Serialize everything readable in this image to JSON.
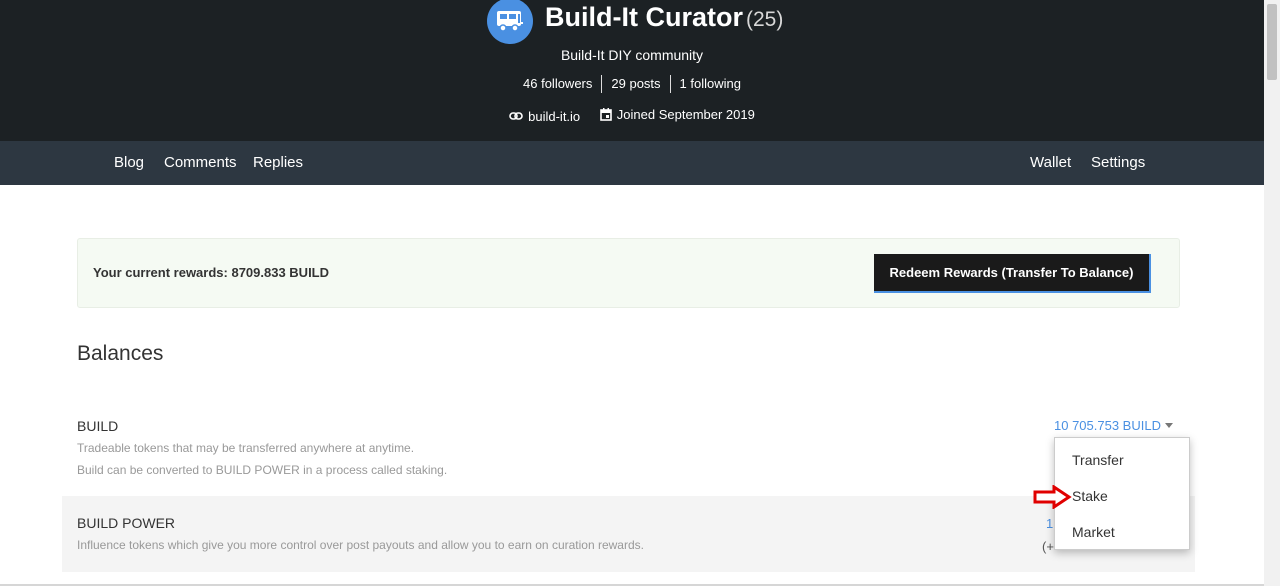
{
  "profile": {
    "name": "Build-It Curator",
    "reputation": "(25)",
    "about": "Build-It DIY community",
    "stats": {
      "followers": "46 followers",
      "posts": "29 posts",
      "following": "1 following"
    },
    "website": "build-it.io",
    "joined": "Joined September 2019",
    "avatar_icon": "camper-van-icon",
    "avatar_color": "#4a90e2"
  },
  "nav": {
    "blog": "Blog",
    "comments": "Comments",
    "replies": "Replies",
    "wallet": "Wallet",
    "settings": "Settings"
  },
  "rewards": {
    "text": "Your current rewards: 8709.833 BUILD",
    "redeem_label": "Redeem Rewards (Transfer To Balance)"
  },
  "balances": {
    "title": "Balances",
    "build": {
      "name": "BUILD",
      "desc1": "Tradeable tokens that may be transferred anywhere at anytime.",
      "desc2": "Build can be converted to BUILD POWER in a process called staking.",
      "value": "10 705.753 BUILD"
    },
    "build_power": {
      "name": "BUILD POWER",
      "desc": "Influence tokens which give you more control over post payouts and allow you to earn on curation rewards.",
      "value_partial": "1",
      "delegated_partial": "(+"
    }
  },
  "dropdown": {
    "options": [
      "Transfer",
      "Stake",
      "Market"
    ]
  },
  "colors": {
    "header_bg": "#1c2124",
    "nav_bg": "#2d3741",
    "link": "#4a90e2",
    "annotation_arrow": "#e00000"
  }
}
